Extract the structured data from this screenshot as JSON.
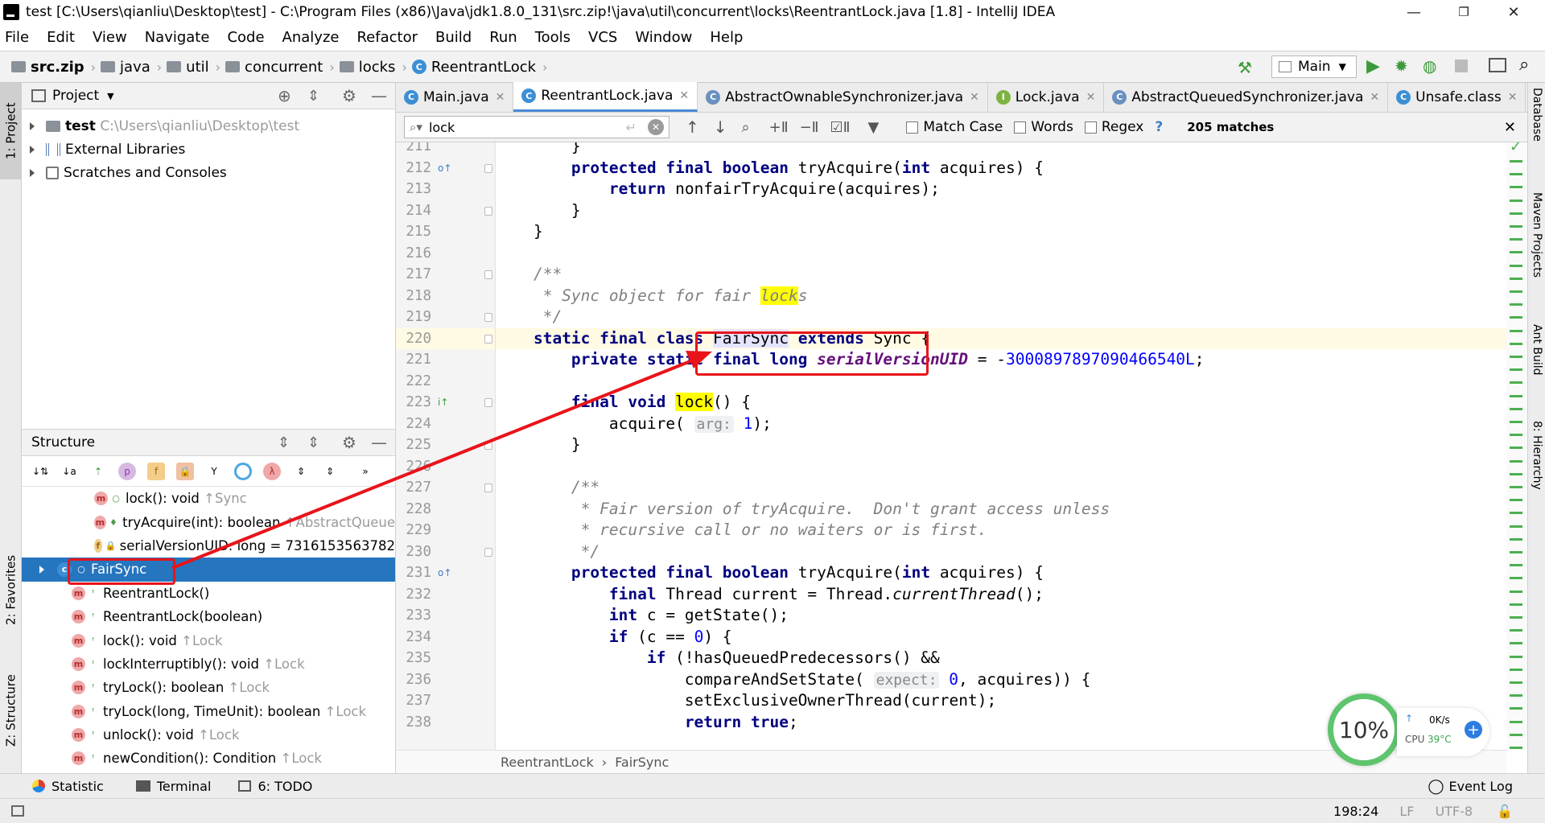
{
  "window": {
    "title": "test [C:\\Users\\qianliu\\Desktop\\test] - C:\\Program Files (x86)\\Java\\jdk1.8.0_131\\src.zip!\\java\\util\\concurrent\\locks\\ReentrantLock.java [1.8] - IntelliJ IDEA",
    "minimize": "—",
    "restore": "❐",
    "close": "✕"
  },
  "menu": [
    "File",
    "Edit",
    "View",
    "Navigate",
    "Code",
    "Analyze",
    "Refactor",
    "Build",
    "Run",
    "Tools",
    "VCS",
    "Window",
    "Help"
  ],
  "nav": {
    "crumbs": [
      "src.zip",
      "java",
      "util",
      "concurrent",
      "locks",
      "ReentrantLock"
    ],
    "run_config": "Main"
  },
  "left_tools": {
    "project": "1: Project",
    "favorites": "2: Favorites",
    "structure": "Z: Structure"
  },
  "right_tools": {
    "database": "Database",
    "maven": "Maven Projects",
    "ant": "Ant Build",
    "hierarchy": "8: Hierarchy"
  },
  "project_panel": {
    "title": "Project",
    "items": [
      {
        "name": "test",
        "path": "C:\\Users\\qianliu\\Desktop\\test"
      },
      {
        "name": "External Libraries",
        "path": ""
      },
      {
        "name": "Scratches and Consoles",
        "path": ""
      }
    ]
  },
  "structure_panel": {
    "title": "Structure",
    "items": [
      {
        "icon": "m",
        "label": "lock(): void",
        "origin": "↑Sync",
        "indent": 2
      },
      {
        "icon": "m",
        "label": "tryAcquire(int): boolean",
        "origin": "↑AbstractQueue",
        "indent": 2
      },
      {
        "icon": "f",
        "label": "serialVersionUID: long = 7316153563782",
        "origin": "",
        "indent": 2
      },
      {
        "icon": "c",
        "label": "FairSync",
        "origin": "",
        "indent": 1,
        "selected": true
      },
      {
        "icon": "m",
        "label": "ReentrantLock()",
        "origin": "",
        "indent": 1
      },
      {
        "icon": "m",
        "label": "ReentrantLock(boolean)",
        "origin": "",
        "indent": 1
      },
      {
        "icon": "m",
        "label": "lock(): void",
        "origin": "↑Lock",
        "indent": 1
      },
      {
        "icon": "m",
        "label": "lockInterruptibly(): void",
        "origin": "↑Lock",
        "indent": 1
      },
      {
        "icon": "m",
        "label": "tryLock(): boolean",
        "origin": "↑Lock",
        "indent": 1
      },
      {
        "icon": "m",
        "label": "tryLock(long, TimeUnit): boolean",
        "origin": "↑Lock",
        "indent": 1
      },
      {
        "icon": "m",
        "label": "unlock(): void",
        "origin": "↑Lock",
        "indent": 1
      },
      {
        "icon": "m",
        "label": "newCondition(): Condition",
        "origin": "↑Lock",
        "indent": 1
      }
    ]
  },
  "editor_tabs": [
    {
      "label": "Main.java",
      "active": false
    },
    {
      "label": "ReentrantLock.java",
      "active": true
    },
    {
      "label": "AbstractOwnableSynchronizer.java",
      "active": false
    },
    {
      "label": "Lock.java",
      "active": false
    },
    {
      "label": "AbstractQueuedSynchronizer.java",
      "active": false
    },
    {
      "label": "Unsafe.class",
      "active": false
    }
  ],
  "find": {
    "query": "lock",
    "match_case": "Match Case",
    "words": "Words",
    "regex": "Regex",
    "help": "?",
    "matches": "205 matches"
  },
  "code_lines": [
    {
      "n": "211",
      "html": "        }"
    },
    {
      "n": "212",
      "html": "        <span class='kw'>protected final boolean</span> tryAcquire(<span class='kw'>int</span> acquires) {"
    },
    {
      "n": "213",
      "html": "            <span class='kw'>return</span> nonfairTryAcquire(acquires);"
    },
    {
      "n": "214",
      "html": "        }"
    },
    {
      "n": "215",
      "html": "    }"
    },
    {
      "n": "216",
      "html": ""
    },
    {
      "n": "217",
      "html": "    <span class='cm'>/**</span>"
    },
    {
      "n": "218",
      "html": "<span class='cm'>     * Sync object for fair <span class='hl'>lock</span>s</span>"
    },
    {
      "n": "219",
      "html": "<span class='cm'>     */</span>"
    },
    {
      "n": "220",
      "html": "    <span class='kw'>static final class</span> <span class='hlcls'>FairSync</span> <span class='kw'>extends</span> Sync {"
    },
    {
      "n": "221",
      "html": "        <span class='kw'>private static final long</span> <span class='fld'>serialVersionUID</span> = -<span class='num'>3000897897090466540L</span>;"
    },
    {
      "n": "222",
      "html": ""
    },
    {
      "n": "223",
      "html": "        <span class='kw'>final void</span> <span class='hl'>lock</span>() {"
    },
    {
      "n": "224",
      "html": "            acquire( <span class='hint'>arg:</span> <span class='num'>1</span>);"
    },
    {
      "n": "225",
      "html": "        }"
    },
    {
      "n": "226",
      "html": ""
    },
    {
      "n": "227",
      "html": "        <span class='cm'>/**</span>"
    },
    {
      "n": "228",
      "html": "<span class='cm'>         * Fair version of tryAcquire.  Don't grant access unless</span>"
    },
    {
      "n": "229",
      "html": "<span class='cm'>         * recursive call or no waiters or is first.</span>"
    },
    {
      "n": "230",
      "html": "<span class='cm'>         */</span>"
    },
    {
      "n": "231",
      "html": "        <span class='kw'>protected final boolean</span> tryAcquire(<span class='kw'>int</span> acquires) {"
    },
    {
      "n": "232",
      "html": "            <span class='kw'>final</span> Thread current = Thread.<i>currentThread</i>();"
    },
    {
      "n": "233",
      "html": "            <span class='kw'>int</span> c = getState();"
    },
    {
      "n": "234",
      "html": "            <span class='kw'>if</span> (c == <span class='num'>0</span>) {"
    },
    {
      "n": "235",
      "html": "                <span class='kw'>if</span> (!hasQueuedPredecessors() &amp;&amp;"
    },
    {
      "n": "236",
      "html": "                    compareAndSetState( <span class='hint'>expect:</span> <span class='num'>0</span>, acquires)) {"
    },
    {
      "n": "237",
      "html": "                    setExclusiveOwnerThread(current);"
    },
    {
      "n": "238",
      "html": "                    <span class='kw'>return true</span>;"
    }
  ],
  "editor_breadcrumb": [
    "ReentrantLock",
    "FairSync"
  ],
  "bottom_tools": [
    "Statistic",
    "Terminal",
    "6: TODO",
    "Event Log"
  ],
  "status": {
    "position": "198:24",
    "line_sep": "LF",
    "encoding": "UTF-8"
  },
  "widget": {
    "cpu_pct": "10%",
    "net": "0K/s",
    "cpu_label": "CPU",
    "cpu_temp": "39°C",
    "plus": "+"
  },
  "colors": {
    "accent": "#2675bf",
    "keyword": "#000080",
    "annotation_red": "#e8141a"
  }
}
